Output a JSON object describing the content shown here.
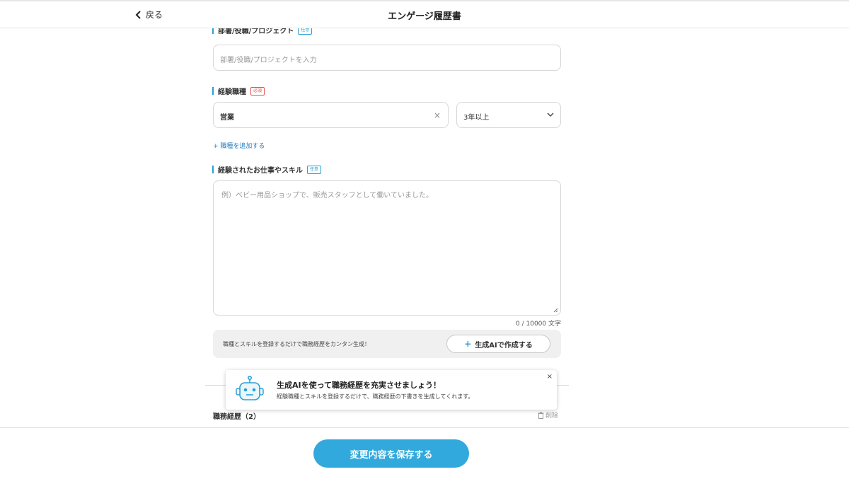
{
  "header": {
    "back_label": "戻る",
    "title": "エンゲージ履歴書"
  },
  "dept_field": {
    "label": "部署/役職/プロジェクト",
    "tag": "任意",
    "placeholder": "部署/役職/プロジェクトを入力"
  },
  "job_type": {
    "label": "経験職種",
    "tag": "必須",
    "value": "営業",
    "clear_icon": "×",
    "years_value": "3年以上"
  },
  "add_job_link": "+ 職種を追加する",
  "skills": {
    "label": "経験されたお仕事やスキル",
    "tag": "任意",
    "placeholder": "例）ベビー用品ショップで、販売スタッフとして働いていました。",
    "counter": "0 / 10000 文字"
  },
  "ai_box": {
    "text": "職種とスキルを登録するだけで職務経歴をカンタン生成！",
    "button_plus": "+",
    "button_label": "生成AIで作成する"
  },
  "career": {
    "title": "職務経歴（2）",
    "delete_label": "削除"
  },
  "toast": {
    "title": "生成AIを使って職務経歴を充実させましょう！",
    "description": "経験職種とスキルを登録するだけで、職務経歴の下書きを生成してくれます。",
    "close": "×"
  },
  "footer": {
    "save_label": "変更内容を保存する"
  },
  "colors": {
    "accent": "#2a9fd6",
    "save_button": "#32a9dc",
    "required": "#e0544b"
  }
}
